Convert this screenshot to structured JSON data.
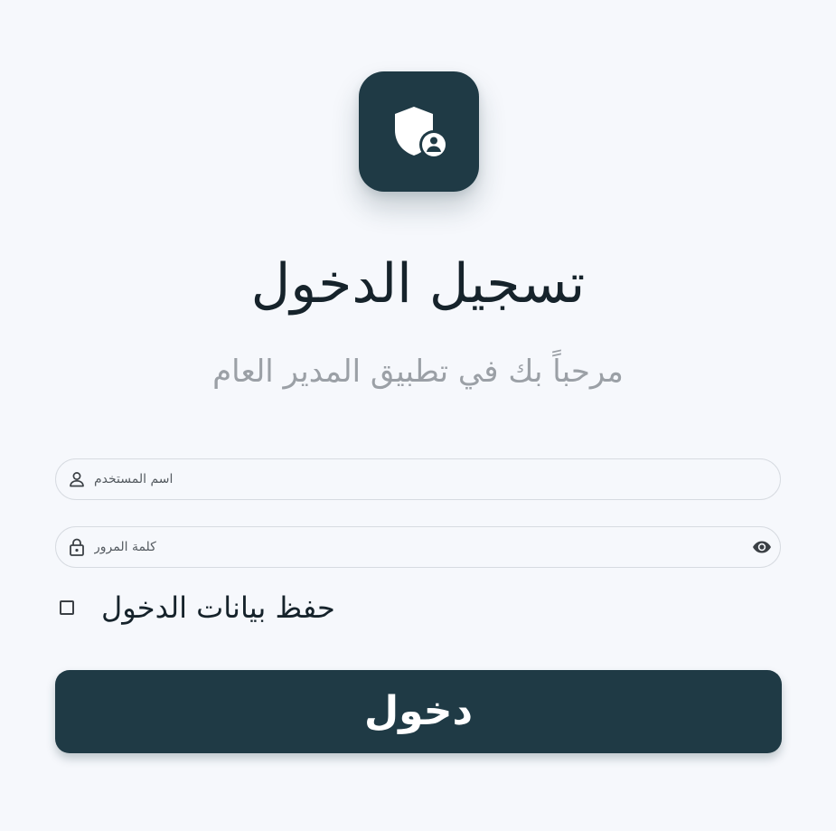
{
  "header": {
    "logo_icon": "shield-user-icon",
    "title": "تسجيل الدخول",
    "subtitle": "مرحباً بك في تطبيق المدير العام"
  },
  "form": {
    "username": {
      "placeholder": "اسم المستخدم",
      "value": "",
      "icon": "user-icon"
    },
    "password": {
      "placeholder": "كلمة المرور",
      "value": "",
      "icon": "lock-icon",
      "toggle_icon": "eye-icon"
    },
    "remember": {
      "label": "حفظ بيانات الدخول",
      "checked": false
    },
    "submit_label": "دخول"
  },
  "colors": {
    "background": "#f6f8fc",
    "primary": "#1f3a45",
    "title_text": "#16232b",
    "subtitle_text": "#9ba0a6",
    "field_border": "#d7dbe1"
  }
}
